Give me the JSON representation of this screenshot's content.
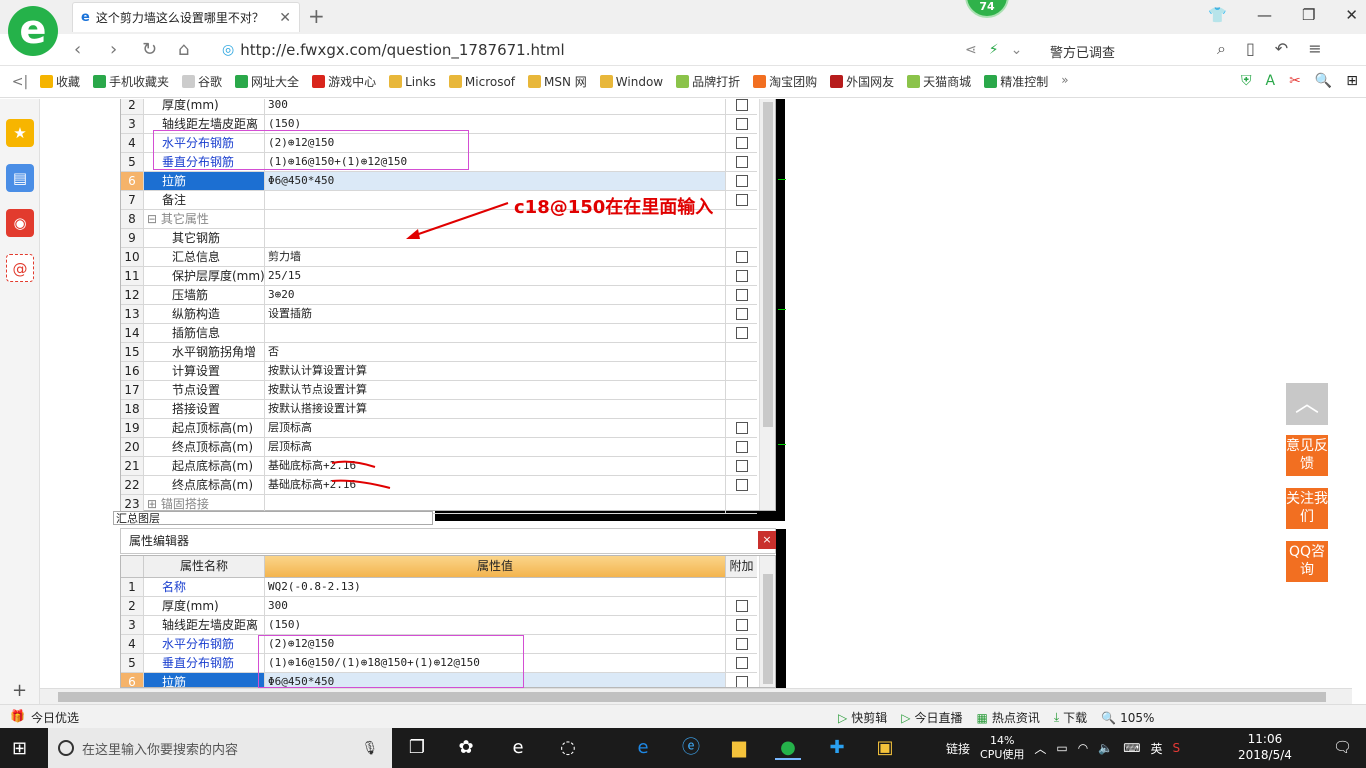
{
  "browser": {
    "tab_title": "这个剪力墙这么设置哪里不对？",
    "badge_count": "74",
    "url": "http://e.fwxgx.com/question_1787671.html",
    "news_ticker": "警方已调查"
  },
  "bookmarks": [
    {
      "label": "收藏",
      "color": "#f5b400"
    },
    {
      "label": "手机收藏夹",
      "color": "#2aa84a"
    },
    {
      "label": "谷歌",
      "color": "#cccccc"
    },
    {
      "label": "网址大全",
      "color": "#2aa84a"
    },
    {
      "label": "游戏中心",
      "color": "#d9251c"
    },
    {
      "label": "Links",
      "color": "#e8b73a"
    },
    {
      "label": "Microsof",
      "color": "#e8b73a"
    },
    {
      "label": "MSN 网",
      "color": "#e8b73a"
    },
    {
      "label": "Window",
      "color": "#e8b73a"
    },
    {
      "label": "品牌打折",
      "color": "#8bc34a"
    },
    {
      "label": "淘宝团购",
      "color": "#f26f21"
    },
    {
      "label": "外国网友",
      "color": "#b71c1c"
    },
    {
      "label": "天猫商城",
      "color": "#8bc34a"
    },
    {
      "label": "精准控制",
      "color": "#2aa84a"
    }
  ],
  "upper_grid": {
    "rows": [
      {
        "no": "2",
        "name": "厚度(mm)",
        "value": "300",
        "check": true,
        "style": ""
      },
      {
        "no": "3",
        "name": "轴线距左墙皮距离",
        "value": "(150)",
        "check": true,
        "style": ""
      },
      {
        "no": "4",
        "name": "水平分布钢筋",
        "value": "(2)⊕12@150",
        "check": true,
        "style": "blue"
      },
      {
        "no": "5",
        "name": "垂直分布钢筋",
        "value": "(1)⊕16@150+(1)⊕12@150",
        "check": true,
        "style": "blue"
      },
      {
        "no": "6",
        "name": "拉筋",
        "value": "Φ6@450*450",
        "check": true,
        "style": "sel"
      },
      {
        "no": "7",
        "name": "备注",
        "value": "",
        "check": true,
        "style": ""
      },
      {
        "no": "8",
        "name": "⊟ 其它属性",
        "value": "",
        "check": false,
        "style": "gray"
      },
      {
        "no": "9",
        "name": "其它钢筋",
        "value": "",
        "check": false,
        "style": "indent"
      },
      {
        "no": "10",
        "name": "汇总信息",
        "value": "剪力墙",
        "check": true,
        "style": "indent"
      },
      {
        "no": "11",
        "name": "保护层厚度(mm)",
        "value": "25/15",
        "check": true,
        "style": "indent"
      },
      {
        "no": "12",
        "name": "压墙筋",
        "value": "3⊕20",
        "check": true,
        "style": "indent"
      },
      {
        "no": "13",
        "name": "纵筋构造",
        "value": "设置插筋",
        "check": true,
        "style": "indent"
      },
      {
        "no": "14",
        "name": "插筋信息",
        "value": "",
        "check": true,
        "style": "indent"
      },
      {
        "no": "15",
        "name": "水平钢筋拐角增",
        "value": "否",
        "check": false,
        "style": "indent"
      },
      {
        "no": "16",
        "name": "计算设置",
        "value": "按默认计算设置计算",
        "check": false,
        "style": "indent"
      },
      {
        "no": "17",
        "name": "节点设置",
        "value": "按默认节点设置计算",
        "check": false,
        "style": "indent"
      },
      {
        "no": "18",
        "name": "搭接设置",
        "value": "按默认搭接设置计算",
        "check": false,
        "style": "indent"
      },
      {
        "no": "19",
        "name": "起点顶标高(m)",
        "value": "层顶标高",
        "check": true,
        "style": "indent"
      },
      {
        "no": "20",
        "name": "终点顶标高(m)",
        "value": "层顶标高",
        "check": true,
        "style": "indent"
      },
      {
        "no": "21",
        "name": "起点底标高(m)",
        "value": "基础底标高+2.16",
        "check": true,
        "style": "indent"
      },
      {
        "no": "22",
        "name": "终点底标高(m)",
        "value": "基础底标高+2.16",
        "check": true,
        "style": "indent"
      },
      {
        "no": "23",
        "name": "⊞ 锚固搭接",
        "value": "",
        "check": false,
        "style": "gray"
      }
    ]
  },
  "annotation": "c18@150在在里面输入",
  "breadcrumb": "汇总图层",
  "editor": {
    "title": "属性编辑器",
    "close": "×",
    "col_name": "属性名称",
    "col_value": "属性值",
    "col_extra": "附加",
    "rows": [
      {
        "no": "1",
        "name": "名称",
        "value": "WQ2(-0.8-2.13)",
        "check": false,
        "style": "blue"
      },
      {
        "no": "2",
        "name": "厚度(mm)",
        "value": "300",
        "check": true,
        "style": ""
      },
      {
        "no": "3",
        "name": "轴线距左墙皮距离",
        "value": "(150)",
        "check": true,
        "style": ""
      },
      {
        "no": "4",
        "name": "水平分布钢筋",
        "value": "(2)⊕12@150",
        "check": true,
        "style": "blue"
      },
      {
        "no": "5",
        "name": "垂直分布钢筋",
        "value": "(1)⊕16@150/(1)⊕18@150+(1)⊕12@150",
        "check": true,
        "style": "blue"
      },
      {
        "no": "6",
        "name": "拉筋",
        "value": "Φ6@450*450",
        "check": true,
        "style": "sel"
      }
    ]
  },
  "floating": {
    "top_icon": "︿",
    "feedback": "意见反馈",
    "follow": "关注我们",
    "qq": "QQ咨询"
  },
  "statusbar": {
    "left": "今日优选",
    "items": [
      "快剪辑",
      "今日直播",
      "热点资讯",
      "下载",
      "105%"
    ]
  },
  "taskbar": {
    "search_placeholder": "在这里输入你要搜索的内容",
    "link": "链接",
    "cpu_pct": "14%",
    "cpu_label": "CPU使用",
    "ime": "英",
    "time": "11:06",
    "date": "2018/5/4"
  }
}
